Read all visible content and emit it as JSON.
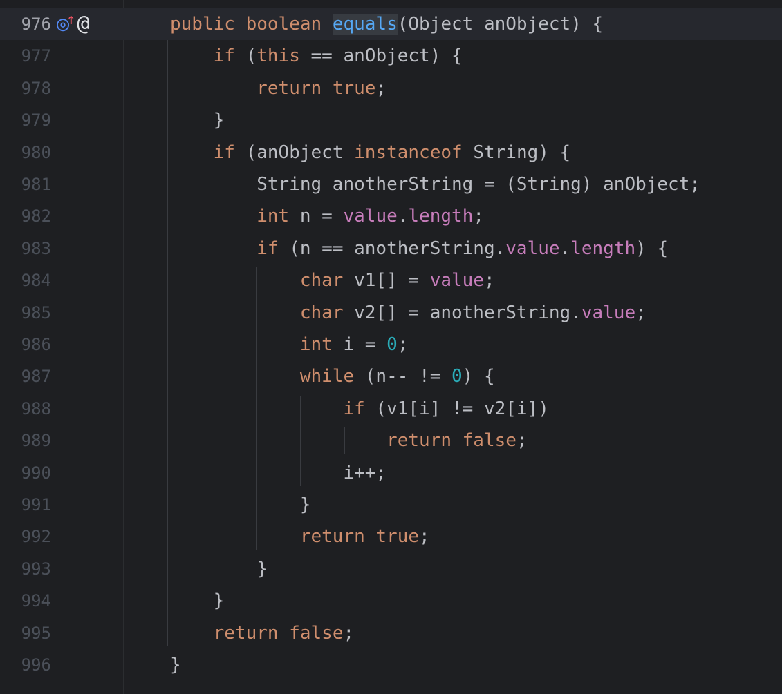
{
  "colors": {
    "background": "#1e1f22",
    "current_line": "#26282e",
    "text": "#bcbec4",
    "keyword": "#cf8e6d",
    "method": "#56a8f5",
    "field": "#c77dbb",
    "number": "#2aacb8",
    "line_number": "#4b5059"
  },
  "gutter_icons": {
    "override": "override-icon",
    "annotation": "annotation-icon"
  },
  "lines": [
    {
      "num": "976",
      "current": true,
      "tokens": [
        {
          "t": "public",
          "c": "kw"
        },
        {
          "t": " "
        },
        {
          "t": "boolean",
          "c": "kw"
        },
        {
          "t": " "
        },
        {
          "t": "equals",
          "c": "fn hl-word"
        },
        {
          "t": "(Object anObject) {"
        }
      ]
    },
    {
      "num": "977",
      "tokens": [
        {
          "t": "    "
        },
        {
          "t": "if",
          "c": "kw"
        },
        {
          "t": " ("
        },
        {
          "t": "this",
          "c": "kw"
        },
        {
          "t": " == anObject) {"
        }
      ]
    },
    {
      "num": "978",
      "tokens": [
        {
          "t": "        "
        },
        {
          "t": "return",
          "c": "kw"
        },
        {
          "t": " "
        },
        {
          "t": "true",
          "c": "kw"
        },
        {
          "t": ";"
        }
      ]
    },
    {
      "num": "979",
      "tokens": [
        {
          "t": "    }"
        }
      ]
    },
    {
      "num": "980",
      "tokens": [
        {
          "t": "    "
        },
        {
          "t": "if",
          "c": "kw"
        },
        {
          "t": " (anObject "
        },
        {
          "t": "instanceof",
          "c": "kw"
        },
        {
          "t": " String) {"
        }
      ]
    },
    {
      "num": "981",
      "tokens": [
        {
          "t": "        String anotherString = (String) anObject;"
        }
      ]
    },
    {
      "num": "982",
      "tokens": [
        {
          "t": "        "
        },
        {
          "t": "int",
          "c": "kw"
        },
        {
          "t": " n = "
        },
        {
          "t": "value",
          "c": "fld"
        },
        {
          "t": "."
        },
        {
          "t": "length",
          "c": "fld"
        },
        {
          "t": ";"
        }
      ]
    },
    {
      "num": "983",
      "tokens": [
        {
          "t": "        "
        },
        {
          "t": "if",
          "c": "kw"
        },
        {
          "t": " (n == anotherString."
        },
        {
          "t": "value",
          "c": "fld"
        },
        {
          "t": "."
        },
        {
          "t": "length",
          "c": "fld"
        },
        {
          "t": ") {"
        }
      ]
    },
    {
      "num": "984",
      "tokens": [
        {
          "t": "            "
        },
        {
          "t": "char",
          "c": "kw"
        },
        {
          "t": " v1[] = "
        },
        {
          "t": "value",
          "c": "fld"
        },
        {
          "t": ";"
        }
      ]
    },
    {
      "num": "985",
      "tokens": [
        {
          "t": "            "
        },
        {
          "t": "char",
          "c": "kw"
        },
        {
          "t": " v2[] = anotherString."
        },
        {
          "t": "value",
          "c": "fld"
        },
        {
          "t": ";"
        }
      ]
    },
    {
      "num": "986",
      "tokens": [
        {
          "t": "            "
        },
        {
          "t": "int",
          "c": "kw"
        },
        {
          "t": " i = "
        },
        {
          "t": "0",
          "c": "num"
        },
        {
          "t": ";"
        }
      ]
    },
    {
      "num": "987",
      "tokens": [
        {
          "t": "            "
        },
        {
          "t": "while",
          "c": "kw"
        },
        {
          "t": " (n-- != "
        },
        {
          "t": "0",
          "c": "num"
        },
        {
          "t": ") {"
        }
      ]
    },
    {
      "num": "988",
      "tokens": [
        {
          "t": "                "
        },
        {
          "t": "if",
          "c": "kw"
        },
        {
          "t": " (v1[i] != v2[i])"
        }
      ]
    },
    {
      "num": "989",
      "tokens": [
        {
          "t": "                    "
        },
        {
          "t": "return",
          "c": "kw"
        },
        {
          "t": " "
        },
        {
          "t": "false",
          "c": "kw"
        },
        {
          "t": ";"
        }
      ]
    },
    {
      "num": "990",
      "tokens": [
        {
          "t": "                i++;"
        }
      ]
    },
    {
      "num": "991",
      "tokens": [
        {
          "t": "            }"
        }
      ]
    },
    {
      "num": "992",
      "tokens": [
        {
          "t": "            "
        },
        {
          "t": "return",
          "c": "kw"
        },
        {
          "t": " "
        },
        {
          "t": "true",
          "c": "kw"
        },
        {
          "t": ";"
        }
      ]
    },
    {
      "num": "993",
      "tokens": [
        {
          "t": "        }"
        }
      ]
    },
    {
      "num": "994",
      "tokens": [
        {
          "t": "    }"
        }
      ]
    },
    {
      "num": "995",
      "tokens": [
        {
          "t": "    "
        },
        {
          "t": "return",
          "c": "kw"
        },
        {
          "t": " "
        },
        {
          "t": "false",
          "c": "kw"
        },
        {
          "t": ";"
        }
      ]
    },
    {
      "num": "996",
      "tokens": [
        {
          "t": "}"
        }
      ]
    }
  ]
}
